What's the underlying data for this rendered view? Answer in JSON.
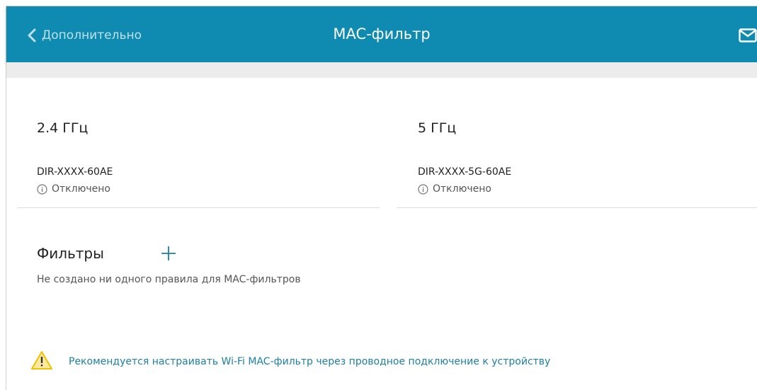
{
  "header": {
    "back_label": "Дополнительно",
    "title": "MAC-фильтр",
    "bg_color": "#0f8ab0"
  },
  "bands": [
    {
      "title": "2.4 ГГц",
      "ssid": "DIR-XXXX-60AE",
      "status": "Отключено"
    },
    {
      "title": "5 ГГц",
      "ssid": "DIR-XXXX-5G-60AE",
      "status": "Отключено"
    }
  ],
  "filters": {
    "title": "Фильтры",
    "empty_text": "Не создано ни одного правила для MAC-фильтров"
  },
  "warning": {
    "text": "Рекомендуется настраивать Wi-Fi MAC-фильтр через проводное подключение к устройству",
    "icon_color": "#f2c200"
  },
  "icons": [
    "chevron-left-icon",
    "mail-icon",
    "info-icon",
    "plus-icon",
    "warning-icon"
  ]
}
